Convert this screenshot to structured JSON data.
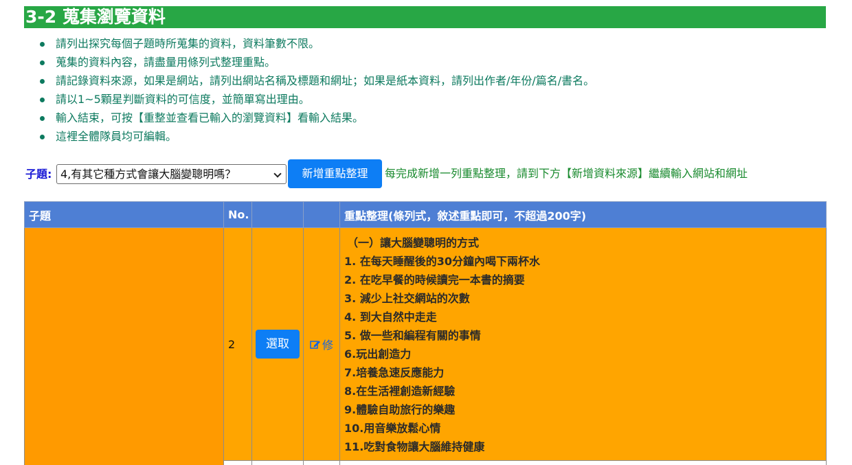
{
  "section": {
    "title": "3-2 蒐集瀏覽資料"
  },
  "instructions": [
    "請列出探究每個子題時所蒐集的資料，資料筆數不限。",
    "蒐集的資料內容，請盡量用條列式整理重點。",
    "請記錄資料來源，如果是網站，請列出網站名稱及標題和網址；如果是紙本資料，請列出作者/年份/篇名/書名。",
    "請以1~5顆星判斷資料的可信度，並簡單寫出理由。",
    "輸入結束，可按【重整並查看已輸入的瀏覽資料】看輸入結果。",
    "這裡全體隊員均可編輯。"
  ],
  "topic": {
    "label": "子題:",
    "selected": "4,有其它種方式會讓大腦變聰明嗎？",
    "add_button": "新增重點整理",
    "hint": "每完成新增一列重點整理，請到下方【新增資料來源】繼續輸入網站和網址"
  },
  "table": {
    "headers": {
      "topic": "子題",
      "no": "No.",
      "select": "",
      "edit": "",
      "notes": "重點整理(條列式，敘述重點即可，不超過200字)"
    },
    "rows": [
      {
        "no": "2",
        "select_label": "選取",
        "edit_label": "修",
        "notes": [
          "（一）讓大腦變聰明的方式",
          "1. 在每天睡醒後的30分鐘內喝下兩杯水",
          "2. 在吃早餐的時候讀完一本書的摘要",
          "3. 減少上社交網站的次數",
          "4. 到大自然中走走",
          "5. 做一些和編程有關的事情",
          "6.玩出創造力",
          "7.培養急速反應能力",
          "8.在生活裡創造新經驗",
          "9.體驗自助旅行的樂趣",
          "10.用音樂放鬆心情",
          "11.吃對食物讓大腦維持健康"
        ]
      }
    ]
  },
  "colors": {
    "title_bg": "#28a745",
    "instruction_text": "#0d7a5f",
    "button_blue": "#0d7ef5",
    "header_bg": "#4e7fd4",
    "row_orange": "#ffa500"
  }
}
